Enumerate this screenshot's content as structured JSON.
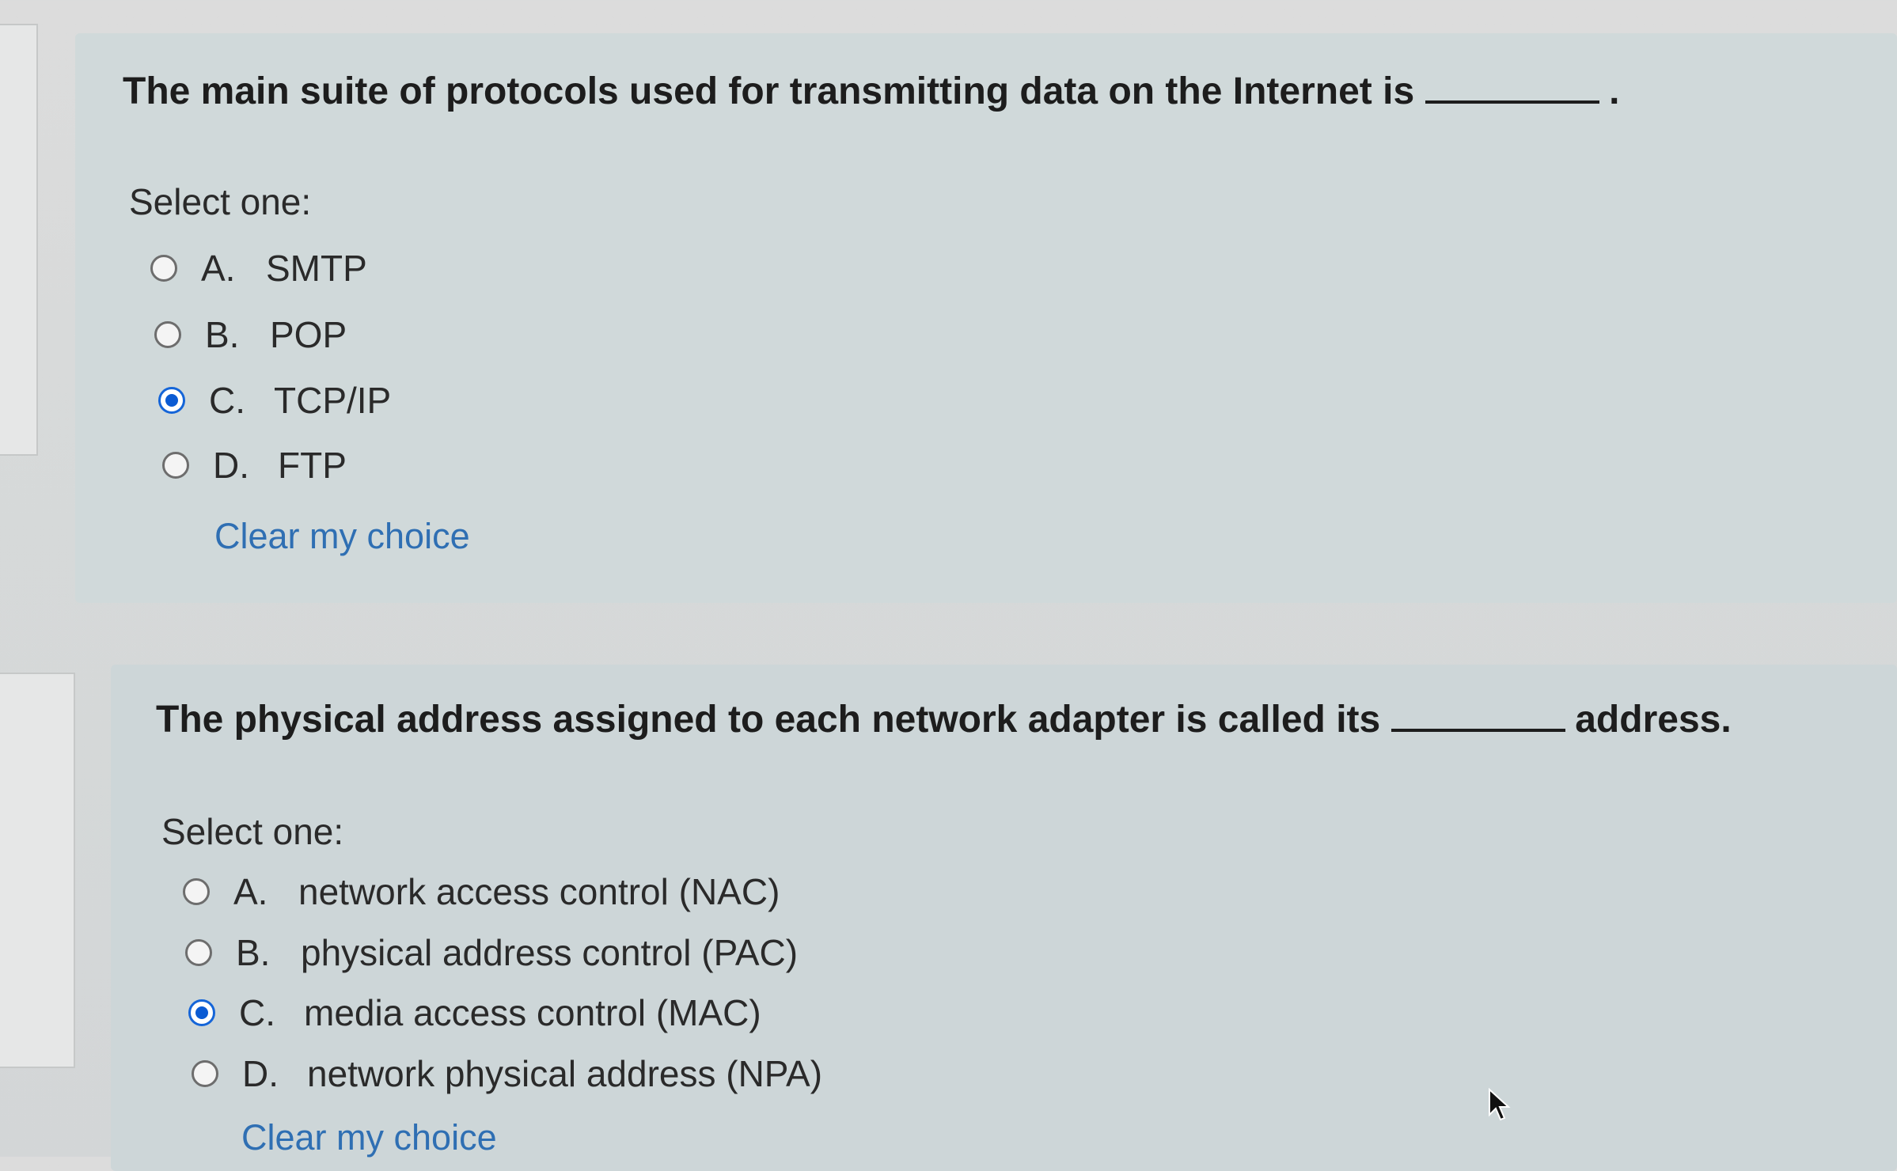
{
  "question1": {
    "text_before": "The main suite of protocols used for transmitting data on the Internet is",
    "text_after": ".",
    "select_label": "Select one:",
    "options": [
      {
        "letter": "A.",
        "label": "SMTP",
        "checked": false
      },
      {
        "letter": "B.",
        "label": "POP",
        "checked": false
      },
      {
        "letter": "C.",
        "label": "TCP/IP",
        "checked": true
      },
      {
        "letter": "D.",
        "label": "FTP",
        "checked": false
      }
    ],
    "clear_label": "Clear my choice"
  },
  "question2": {
    "text_before": "The physical address assigned to each network adapter is called its",
    "text_after": "address.",
    "select_label": "Select one:",
    "options": [
      {
        "letter": "A.",
        "label": "network access control (NAC)",
        "checked": false
      },
      {
        "letter": "B.",
        "label": "physical address control (PAC)",
        "checked": false
      },
      {
        "letter": "C.",
        "label": "media access control (MAC)",
        "checked": true
      },
      {
        "letter": "D.",
        "label": "network physical address (NPA)",
        "checked": false
      }
    ],
    "clear_label": "Clear my choice"
  },
  "colors": {
    "selected_radio": "#0b5bd3",
    "link": "#2f6fb3"
  }
}
